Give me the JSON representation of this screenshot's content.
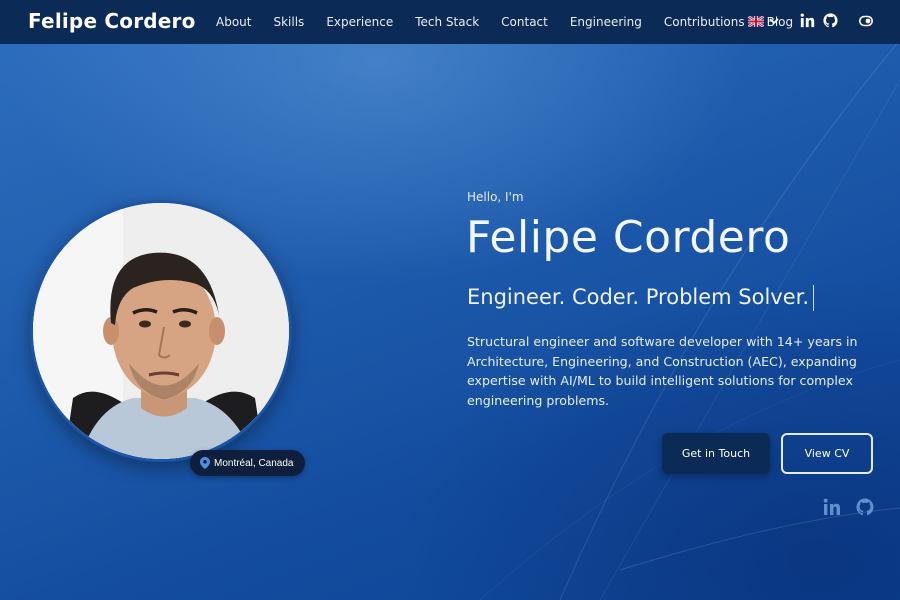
{
  "brand": "Felipe Cordero",
  "nav": {
    "links": [
      "About",
      "Skills",
      "Experience",
      "Tech Stack",
      "Contact",
      "Engineering",
      "Contributions",
      "Blog"
    ],
    "language_flag": "uk-flag-icon",
    "icons": [
      "linkedin-icon",
      "github-icon",
      "theme-toggle-icon"
    ]
  },
  "hero": {
    "greeting": "Hello, I'm",
    "name": "Felipe Cordero",
    "tagline": "Engineer. Coder. Problem Solver.",
    "bio": "Structural engineer and software developer with 14+ years in Architecture, Engineering, and Construction (AEC), expanding expertise with AI/ML to build intelligent solutions for complex engineering problems.",
    "primary_button": "Get in Touch",
    "secondary_button": "View CV",
    "location": "Montréal, Canada",
    "social_icons": [
      "linkedin-icon",
      "github-icon"
    ]
  },
  "colors": {
    "navbar": "#0b2a55",
    "hero_blue": "#1f5cad",
    "button_dark": "#0b2a55"
  }
}
